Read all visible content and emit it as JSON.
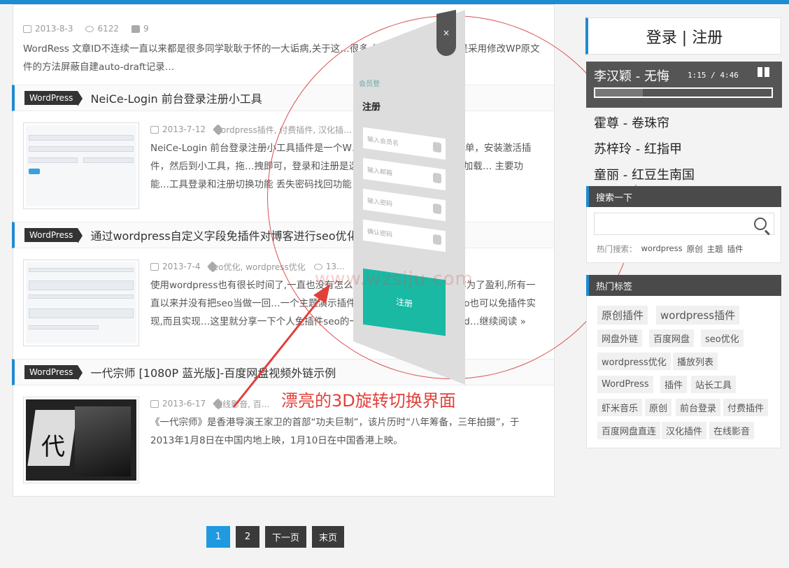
{
  "post_top": {
    "date": "2013-8-3",
    "views": "6122",
    "comments": "9",
    "excerpt": "WordRess 文章ID不连续一直以来都是很多同学耿耿于怀的一大诟病,关于这…很多,但是几乎90%以上都是采用修改WP原文件的方法屏蔽自建auto-draft记录…"
  },
  "posts": [
    {
      "category": "WordPress",
      "title": "NeiCe-Login 前台登录注册小工具",
      "date": "2013-7-12",
      "tags": "wordpress插件, 付费插件, 汉化插…",
      "excerpt": "NeiCe-Login 前台登录注册小工具插件是一个W…插件，这个插件使用很简单，安装激活插件，然后到小工具，拖…拽即可，登录和注册是选项卡形式，全Ajax检测与加载… 主要功能…工具登录和注册切换功能 丢失密码找回功能 AJAX 验证…继续阅…"
    },
    {
      "category": "WordPress",
      "title": "通过wordpress自定义字段免插件对博客进行seo优化",
      "date": "2013-7-4",
      "tags": "seo优化, wordpress优化",
      "views": "13…",
      "excerpt": "使用wordpress也有很长时间了,一直也没有怎么…而且建立这个博客也并非为了盈利,所有一直以来并没有把seo当做一回…一个主题演示插件的时候无意中发现,其实seo也可以免插件实现,而且实现…这里就分享一下个人免插件seo的一些心得体会,就是通过word…继续阅读 »"
    },
    {
      "category": "WordPress",
      "title": "一代宗师 [1080P 蓝光版]-百度网盘视频外链示例",
      "date": "2013-6-17",
      "tags": "在线影音, 百…",
      "excerpt": "《一代宗师》是香港导演王家卫的首部“功夫巨制”，该片历时“八年筹备，三年拍摄”，于2013年1月8日在中国内地上映，1月10日在中国香港上映。"
    }
  ],
  "pager": [
    "1",
    "2",
    "下一页",
    "末页"
  ],
  "overlay": {
    "annotation": "漂亮的3D旋转切换界面",
    "watermark": "www.wzsiju.com",
    "close": "×",
    "label_a": "会员登",
    "label_b": "注册",
    "rows": [
      "输入会员名",
      "输入邮箱",
      "输入密码",
      "确认密码"
    ],
    "submit": "注册"
  },
  "sidebar": {
    "login": "登录 | 注册",
    "player": {
      "song": "李汉颖 - 无悔",
      "time": "1:15 / 4:46",
      "progress": 0.27
    },
    "playlist": [
      "霍尊 - 卷珠帘",
      "苏梓玲 - 红指甲",
      "童丽 - 红豆生南国"
    ],
    "search_title": "搜索一下",
    "hot_label": "热门搜索：",
    "hot_keywords": [
      "wordpress",
      "原创",
      "主题",
      "插件"
    ],
    "tags_title": "热门标签",
    "tags": [
      "原创插件",
      "wordpress插件",
      "网盘外链",
      "百度网盘",
      "seo优化",
      "wordpress优化",
      "播放列表",
      "WordPress",
      "插件",
      "站长工具",
      "虾米音乐",
      "原创",
      "前台登录",
      "付费插件",
      "百度网盘直连",
      "汉化插件",
      "在线影音"
    ]
  }
}
